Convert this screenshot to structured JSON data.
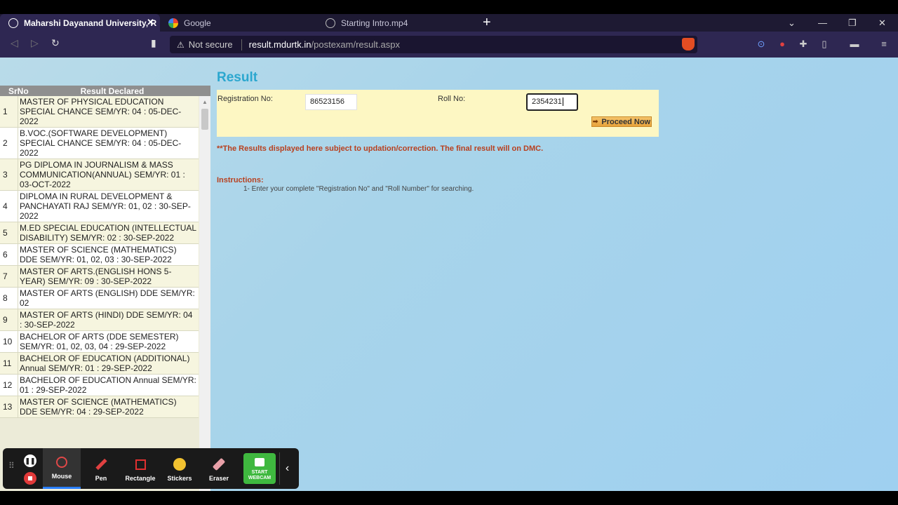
{
  "tabs": [
    {
      "label": "Maharshi Dayanand University, R",
      "active": true
    },
    {
      "label": "Google",
      "active": false
    },
    {
      "label": "Starting Intro.mp4",
      "active": false
    }
  ],
  "toolbar": {
    "not_secure": "Not secure",
    "url_host": "result.mdurtk.in",
    "url_path": "/postexam/result.aspx"
  },
  "sidebar": {
    "col_srno": "SrNo",
    "col_result": "Result Declared",
    "rows": [
      {
        "sr": "1",
        "title": "MASTER OF PHYSICAL EDUCATION SPECIAL CHANCE SEM/YR: 04 : 05-DEC-2022"
      },
      {
        "sr": "2",
        "title": "B.VOC.(SOFTWARE DEVELOPMENT) SPECIAL CHANCE SEM/YR: 04 : 05-DEC-2022"
      },
      {
        "sr": "3",
        "title": "PG DIPLOMA IN JOURNALISM & MASS COMMUNICATION(ANNUAL) SEM/YR: 01 : 03-OCT-2022"
      },
      {
        "sr": "4",
        "title": "DIPLOMA IN RURAL DEVELOPMENT & PANCHAYATI RAJ SEM/YR: 01, 02 : 30-SEP-2022"
      },
      {
        "sr": "5",
        "title": "M.ED SPECIAL EDUCATION (INTELLECTUAL DISABILITY) SEM/YR: 02 : 30-SEP-2022"
      },
      {
        "sr": "6",
        "title": "MASTER OF SCIENCE (MATHEMATICS) DDE SEM/YR: 01, 02, 03 : 30-SEP-2022"
      },
      {
        "sr": "7",
        "title": "MASTER OF ARTS.(ENGLISH HONS 5-YEAR) SEM/YR: 09 : 30-SEP-2022"
      },
      {
        "sr": "8",
        "title": "MASTER OF ARTS (ENGLISH) DDE SEM/YR: 02"
      },
      {
        "sr": "9",
        "title": "MASTER OF ARTS (HINDI) DDE SEM/YR: 04 : 30-SEP-2022"
      },
      {
        "sr": "10",
        "title": "BACHELOR OF ARTS (DDE SEMESTER) SEM/YR: 01, 02, 03, 04 : 29-SEP-2022"
      },
      {
        "sr": "11",
        "title": "BACHELOR OF EDUCATION (ADDITIONAL) Annual SEM/YR: 01 : 29-SEP-2022"
      },
      {
        "sr": "12",
        "title": "BACHELOR OF EDUCATION Annual SEM/YR: 01 : 29-SEP-2022"
      },
      {
        "sr": "13",
        "title": "MASTER OF SCIENCE (MATHEMATICS) DDE SEM/YR: 04 : 29-SEP-2022"
      }
    ]
  },
  "main": {
    "title": "Result",
    "reg_label": "Registration No:",
    "reg_value": "86523156",
    "roll_label": "Roll No:",
    "roll_value": "2354231",
    "proceed_label": "Proceed Now",
    "notice": "**The Results displayed here subject to updation/correction. The final result will on DMC.",
    "instructions_title": "Instructions:",
    "instruction_1": "1- Enter your complete \"Registration No\" and \"Roll Number\" for searching."
  },
  "recorder": {
    "tools": [
      "Mouse",
      "Pen",
      "Rectangle",
      "Stickers",
      "Eraser"
    ],
    "webcam_label_1": "START",
    "webcam_label_2": "WEBCAM"
  }
}
